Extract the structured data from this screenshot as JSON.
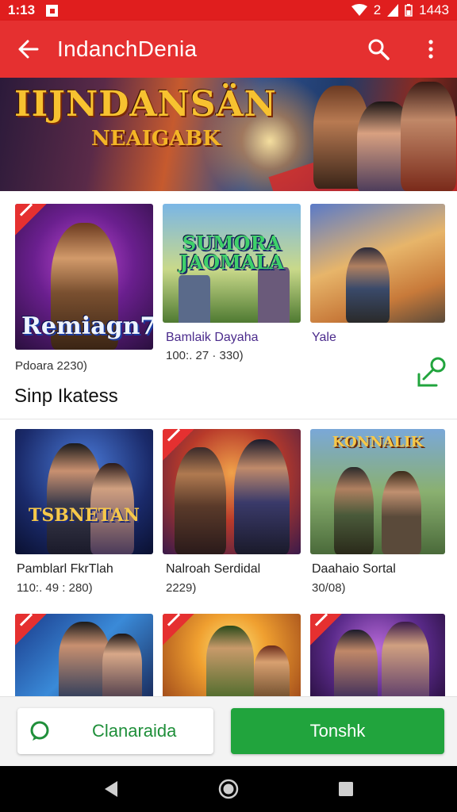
{
  "status_bar": {
    "time": "1:13",
    "right_text": "1443",
    "network_glyph": "2"
  },
  "app_bar": {
    "title": "IndanchDenia"
  },
  "banner": {
    "title_line1": "IIJNDANSÄN",
    "title_line2": "NEAIGABK"
  },
  "featured": [
    {
      "thumb_text": "Remiagn7",
      "title": "",
      "subtitle": "Pdoara 2230)"
    },
    {
      "thumb_text": "SUMORA JAOMALA",
      "title": "Bamlaik Dayaha",
      "subtitle": "100:. 27 · 330)"
    },
    {
      "thumb_text": "",
      "title": "Yale",
      "subtitle": ""
    }
  ],
  "section": {
    "title": "Sinp Ikatess"
  },
  "grid_row_1": [
    {
      "thumb_text": "TSBNETAN",
      "title": "Pamblarl FkrTlah",
      "subtitle": "110:. 49 : 280)"
    },
    {
      "thumb_text": "",
      "title": "Nalroah Serdidal",
      "subtitle": "2229)"
    },
    {
      "thumb_text": "KONNALIK",
      "title": "Daahaio Sortal",
      "subtitle": "30/08)"
    }
  ],
  "actions": {
    "secondary_label": "Clanaraida",
    "primary_label": "Tonshk"
  },
  "colors": {
    "accent_red": "#e53030",
    "action_green": "#21a43d"
  }
}
